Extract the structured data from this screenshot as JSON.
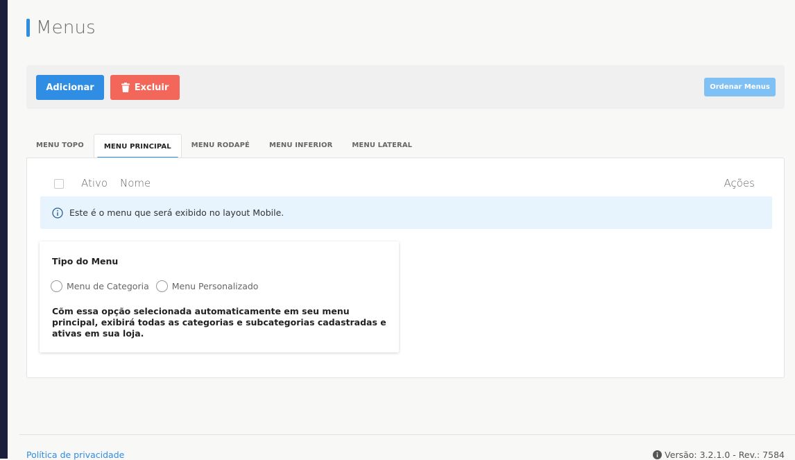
{
  "page": {
    "title": "Menus"
  },
  "toolbar": {
    "add_label": "Adicionar",
    "delete_label": "Excluir",
    "order_label": "Ordenar Menus"
  },
  "tabs": [
    {
      "label": "MENU TOPO",
      "active": false
    },
    {
      "label": "MENU PRINCIPAL",
      "active": true
    },
    {
      "label": "MENU RODAPÉ",
      "active": false
    },
    {
      "label": "MENU INFERIOR",
      "active": false
    },
    {
      "label": "MENU LATERAL",
      "active": false
    }
  ],
  "table": {
    "headers": {
      "ativo": "Ativo",
      "nome": "Nome",
      "acoes": "Ações"
    }
  },
  "info": {
    "text": "Este é o menu que será exibido no layout Mobile."
  },
  "menu_type": {
    "title": "Tipo do Menu",
    "options": [
      "Menu de Categoria",
      "Menu Personalizado"
    ],
    "description": "Cõm essa opção selecionada automaticamente em seu menu principal, exibirá todas as categorias e subcategorias cadastradas e ativas em sua loja."
  },
  "footer": {
    "privacy_link": "Política de privacidade",
    "version": "Versão: 3.2.1.0 - Rev.: 7584"
  },
  "colors": {
    "primary": "#2f8de4",
    "danger": "#f2675a",
    "order_button": "#7fc0f5",
    "info_bg": "#e7f3fd",
    "sidebar": "#1b1f3b"
  },
  "icons": {
    "delete": "trash-icon",
    "info": "info-circle-icon",
    "version": "info-icon"
  }
}
